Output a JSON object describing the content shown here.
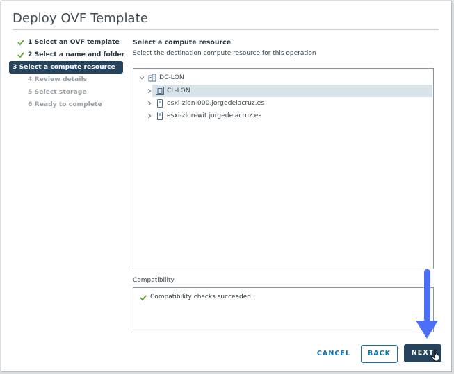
{
  "dialog": {
    "title": "Deploy OVF Template"
  },
  "steps": [
    {
      "label": "1 Select an OVF template",
      "state": "done"
    },
    {
      "label": "2 Select a name and folder",
      "state": "done"
    },
    {
      "label": "3 Select a compute resource",
      "state": "active"
    },
    {
      "label": "4 Review details",
      "state": "pending"
    },
    {
      "label": "5 Select storage",
      "state": "pending"
    },
    {
      "label": "6 Ready to complete",
      "state": "pending"
    }
  ],
  "pane": {
    "title": "Select a compute resource",
    "subtitle": "Select the destination compute resource for this operation"
  },
  "tree": {
    "datacenter": "DC-LON",
    "items": [
      {
        "label": "CL-LON",
        "icon": "cluster-icon",
        "selected": true
      },
      {
        "label": "esxi-zlon-000.jorgedelacruz.es",
        "icon": "host-icon"
      },
      {
        "label": "esxi-zlon-wit.jorgedelacruz.es",
        "icon": "host-icon"
      }
    ]
  },
  "compatibility": {
    "label": "Compatibility",
    "message": "Compatibility checks succeeded."
  },
  "buttons": {
    "cancel": "CANCEL",
    "back": "BACK",
    "next": "NEXT"
  },
  "colors": {
    "accent": "#26435e",
    "link": "#0f73b5",
    "success": "#5aa220",
    "annotation_arrow": "#4c6ef5"
  }
}
